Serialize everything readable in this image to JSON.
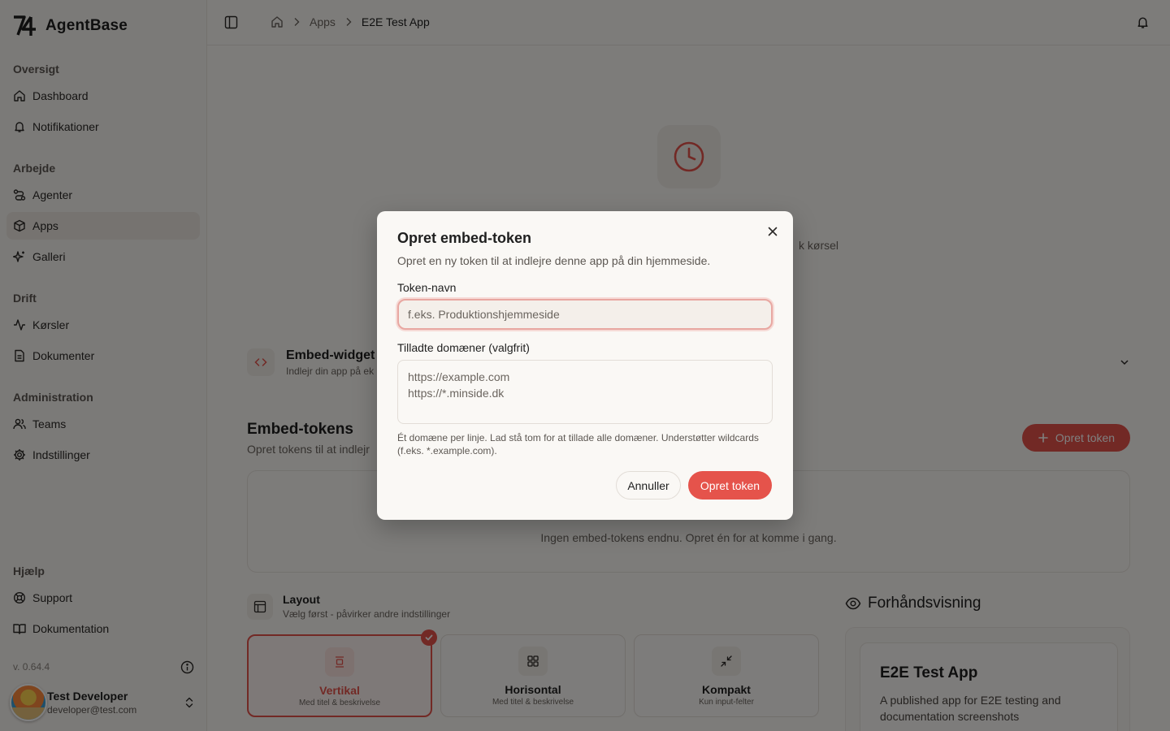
{
  "brand": {
    "name": "AgentBase"
  },
  "sidebar": {
    "groups": [
      {
        "label": "Oversigt",
        "items": [
          {
            "label": "Dashboard",
            "icon": "home-icon"
          },
          {
            "label": "Notifikationer",
            "icon": "bell-icon"
          }
        ]
      },
      {
        "label": "Arbejde",
        "items": [
          {
            "label": "Agenter",
            "icon": "route-icon"
          },
          {
            "label": "Apps",
            "icon": "box-icon",
            "active": true
          },
          {
            "label": "Galleri",
            "icon": "sparkle-icon"
          }
        ]
      },
      {
        "label": "Drift",
        "items": [
          {
            "label": "Kørsler",
            "icon": "activity-icon"
          },
          {
            "label": "Dokumenter",
            "icon": "file-icon"
          }
        ]
      },
      {
        "label": "Administration",
        "items": [
          {
            "label": "Teams",
            "icon": "users-icon"
          },
          {
            "label": "Indstillinger",
            "icon": "gear-icon"
          }
        ]
      },
      {
        "label": "Hjælp",
        "items": [
          {
            "label": "Support",
            "icon": "lifebuoy-icon"
          },
          {
            "label": "Dokumentation",
            "icon": "book-icon"
          }
        ]
      }
    ],
    "version": "v. 0.64.4",
    "user": {
      "name": "Test Developer",
      "email": "developer@test.com"
    }
  },
  "header": {
    "breadcrumb": [
      "Apps",
      "E2E Test App"
    ]
  },
  "main": {
    "empty_run_text": "k kørsel",
    "embed_widget": {
      "title": "Embed-widget",
      "subtitle": "Indlejr din app på ek"
    },
    "tokens": {
      "title": "Embed-tokens",
      "subtitle": "Opret tokens til at indlejr",
      "create_label": "Opret token",
      "empty_text": "Ingen embed-tokens endnu. Opret én for at komme i gang."
    },
    "layout": {
      "title": "Layout",
      "subtitle": "Vælg først - påvirker andre indstillinger",
      "options": [
        {
          "title": "Vertikal",
          "subtitle": "Med titel & beskrivelse",
          "selected": true
        },
        {
          "title": "Horisontal",
          "subtitle": "Med titel & beskrivelse",
          "selected": false
        },
        {
          "title": "Kompakt",
          "subtitle": "Kun input-felter",
          "selected": false
        }
      ]
    },
    "preview": {
      "title": "Forhåndsvisning",
      "app_title": "E2E Test App",
      "app_description": "A published app for E2E testing and documentation screenshots"
    }
  },
  "dialog": {
    "title": "Opret embed-token",
    "description": "Opret en ny token til at indlejre denne app på din hjemmeside.",
    "name_label": "Token-navn",
    "name_value": "",
    "name_placeholder": "f.eks. Produktionshjemmeside",
    "domains_label": "Tilladte domæner (valgfrit)",
    "domains_value": "",
    "domains_placeholder": "https://example.com\nhttps://*.minside.dk",
    "help_text": "Ét domæne per linje. Lad stå tom for at tillade alle domæner. Understøtter wildcards (f.eks. *.example.com).",
    "cancel_label": "Annuller",
    "submit_label": "Opret token"
  },
  "colors": {
    "accent": "#e5534b",
    "background": "#faf8f5",
    "sidebar": "#f7f4f0"
  }
}
